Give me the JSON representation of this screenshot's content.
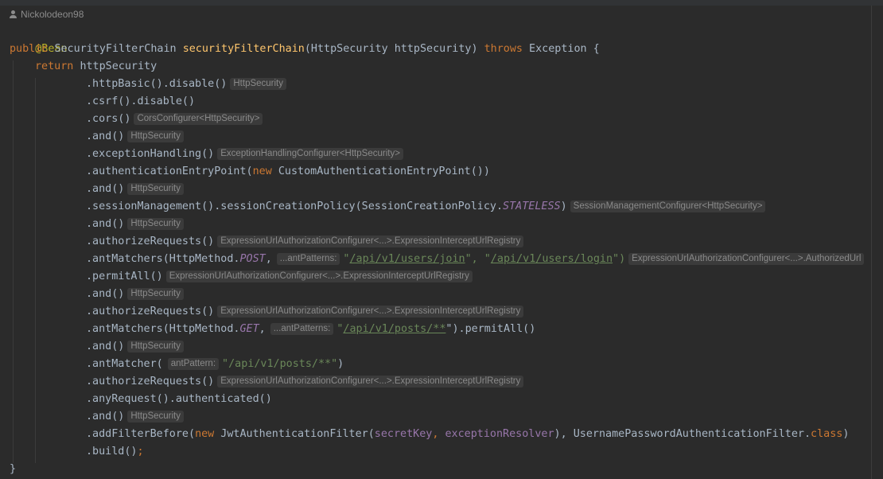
{
  "author": {
    "name": "Nickolodeon98"
  },
  "code": {
    "annotation": "@Bean",
    "signature": {
      "modifier": "public",
      "return_type": "SecurityFilterChain",
      "method_name": "securityFilterChain",
      "params": "(HttpSecurity httpSecurity)",
      "throws_kw": "throws",
      "exception": "Exception {"
    },
    "return_line": {
      "keyword": "return",
      "target": "httpSecurity"
    },
    "chain": [
      {
        "code": ".httpBasic().disable()",
        "hint": "HttpSecurity"
      },
      {
        "code": ".csrf().disable()"
      },
      {
        "code": ".cors()",
        "hint": "CorsConfigurer<HttpSecurity>"
      },
      {
        "code": ".and()",
        "hint": "HttpSecurity"
      },
      {
        "code": ".exceptionHandling()",
        "hint": "ExceptionHandlingConfigurer<HttpSecurity>"
      },
      {
        "pre": ".authenticationEntryPoint(",
        "kw": "new",
        "post": " CustomAuthenticationEntryPoint())"
      },
      {
        "code": ".and()",
        "hint": "HttpSecurity"
      },
      {
        "pre": ".sessionManagement().sessionCreationPolicy(SessionCreationPolicy.",
        "const": "STATELESS",
        "post": ")",
        "hint": "SessionManagementConfigurer<HttpSecurity>"
      },
      {
        "code": ".and()",
        "hint": "HttpSecurity"
      },
      {
        "code": ".authorizeRequests()",
        "hint": "ExpressionUrlAuthorizationConfigurer<...>.ExpressionInterceptUrlRegistry"
      },
      {
        "pre": ".antMatchers(HttpMethod.",
        "const": "POST",
        "post": ",",
        "param_hint": "...antPatterns:",
        "q1": "\"",
        "url1": "/api/v1/users/join",
        "mid": "\", \"",
        "url2": "/api/v1/users/login",
        "end": "\")",
        "hint": "ExpressionUrlAuthorizationConfigurer<...>.AuthorizedUrl"
      },
      {
        "code": ".permitAll()",
        "hint": "ExpressionUrlAuthorizationConfigurer<...>.ExpressionInterceptUrlRegistry"
      },
      {
        "code": ".and()",
        "hint": "HttpSecurity"
      },
      {
        "code": ".authorizeRequests()",
        "hint": "ExpressionUrlAuthorizationConfigurer<...>.ExpressionInterceptUrlRegistry"
      },
      {
        "pre": ".antMatchers(HttpMethod.",
        "const": "GET",
        "post": ",",
        "param_hint": "...antPatterns:",
        "q1": "\"",
        "url1": "/api/v1/posts/**",
        "end": "\").permitAll()"
      },
      {
        "code": ".and()",
        "hint": "HttpSecurity"
      },
      {
        "pre": ".antMatcher(",
        "param_hint": "antPattern:",
        "str": "\"/api/v1/posts/**\"",
        "end": ")"
      },
      {
        "code": ".authorizeRequests()",
        "hint": "ExpressionUrlAuthorizationConfigurer<...>.ExpressionInterceptUrlRegistry"
      },
      {
        "code": ".anyRequest().authenticated()"
      },
      {
        "code": ".and()",
        "hint": "HttpSecurity"
      },
      {
        "pre": ".addFilterBefore(",
        "kw": "new",
        "post": " JwtAuthenticationFilter(",
        "field1": "secretKey",
        "sep": ", ",
        "field2": "exceptionResolver",
        "post2": "), UsernamePasswordAuthenticationFilter.",
        "kw2": "class",
        "end": ")"
      },
      {
        "code": ".build()",
        "semi": ";"
      }
    ],
    "closing_brace": "}"
  }
}
